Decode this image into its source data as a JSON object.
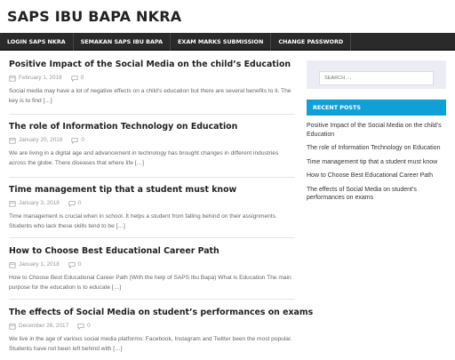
{
  "site": {
    "title": "SAPS IBU BAPA NKRA"
  },
  "nav": {
    "items": [
      {
        "label": "LOGIN SAPS NKRA"
      },
      {
        "label": "SEMAKAN SAPS IBU BAPA"
      },
      {
        "label": "EXAM MARKS SUBMISSION"
      },
      {
        "label": "CHANGE PASSWORD"
      }
    ]
  },
  "posts": [
    {
      "title": "Positive Impact of the Social Media on the child’s Education",
      "date": "February 1, 2018",
      "comments": "0",
      "excerpt": "Social media may have a lot of negative effects on a child’s education but there are several benefits to it. The key is to find […]"
    },
    {
      "title": "The role of Information Technology on Education",
      "date": "January 20, 2018",
      "comments": "0",
      "excerpt": "We are living in a digital age and advancement in technology has brought changes in different industries across the globe. There diseases that where life […]"
    },
    {
      "title": "Time management tip that a student must know",
      "date": "January 3, 2018",
      "comments": "0",
      "excerpt": "Time management is crucial when in school. It helps a student from falling behind on their assignments. Students who lack these skills tend to be […]"
    },
    {
      "title": "How to Choose Best Educational Career Path",
      "date": "January 1, 2018",
      "comments": "0",
      "excerpt": "How to Choose Best Educational Career Path (With the help of SAPS Ibu Bapa) What is Education The main purpose for the education is to educate […]"
    },
    {
      "title": "The effects of Social Media on student’s performances on exams",
      "date": "December 26, 2017",
      "comments": "0",
      "excerpt": "We live in the age of various social media platforms: Facebook, Instagram and Twitter been the most popular. Students have not been left behind with […]"
    }
  ],
  "sidebar": {
    "search_placeholder": "SEARCH …",
    "recent_title": "RECENT POSTS",
    "recent": [
      {
        "label": "Positive Impact of the Social Media on the child’s Education"
      },
      {
        "label": "The role of Information Technology on Education"
      },
      {
        "label": "Time management tip that a student must know"
      },
      {
        "label": "How to Choose Best Educational Career Path"
      },
      {
        "label": "The effects of Social Media on student’s performances on exams"
      }
    ]
  },
  "icons": {
    "date": "calendar-icon",
    "comments": "comment-icon"
  },
  "colors": {
    "nav_bg": "#2a2a2a",
    "accent": "#0fa0d8",
    "search_bg": "#ececf5"
  }
}
